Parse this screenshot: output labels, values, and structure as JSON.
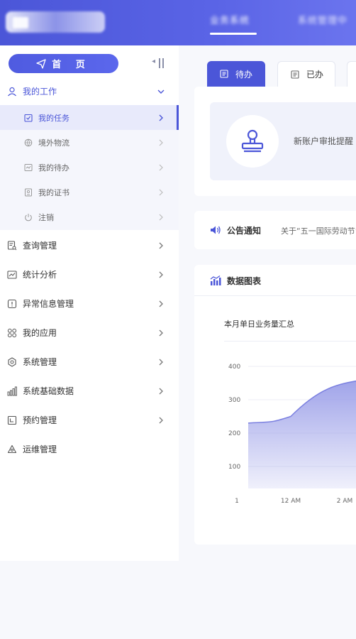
{
  "header": {
    "nav": [
      {
        "label": "业务系统"
      },
      {
        "label": "系统管理中"
      }
    ]
  },
  "sidebar": {
    "home_label": "首 页",
    "groups": [
      {
        "label": "我的工作",
        "icon": "user-icon",
        "expanded": true,
        "children": [
          {
            "label": "我的任务",
            "icon": "task-icon",
            "active": true
          },
          {
            "label": "境外物流",
            "icon": "globe-icon"
          },
          {
            "label": "我的待办",
            "icon": "todo-icon"
          },
          {
            "label": "我的证书",
            "icon": "certificate-icon"
          },
          {
            "label": "注销",
            "icon": "power-icon"
          }
        ]
      },
      {
        "label": "查询管理",
        "icon": "query-icon"
      },
      {
        "label": "统计分析",
        "icon": "stats-icon"
      },
      {
        "label": "异常信息管理",
        "icon": "warning-icon"
      },
      {
        "label": "我的应用",
        "icon": "apps-icon"
      },
      {
        "label": "系统管理",
        "icon": "gear-icon"
      },
      {
        "label": "系统基础数据",
        "icon": "bars-icon"
      },
      {
        "label": "预约管理",
        "icon": "calendar-icon"
      },
      {
        "label": "运维管理",
        "icon": "ops-icon"
      }
    ]
  },
  "tabs": [
    {
      "label": "待办",
      "active": true
    },
    {
      "label": "已办",
      "active": false
    }
  ],
  "task_notice": {
    "text": "新账户审批提醒"
  },
  "announcement": {
    "title": "公告通知",
    "text": "关于“五一国际劳动节”"
  },
  "chart_card": {
    "title": "数据图表",
    "subtitle": "本月单日业务量汇总"
  },
  "colors": {
    "primary": "#4b56d8",
    "area_fill": "#9a9ee8"
  },
  "chart_data": {
    "type": "area",
    "x": [
      "1",
      "12 AM",
      "2 AM"
    ],
    "y_ticks": [
      100,
      200,
      300,
      400
    ],
    "ylim": [
      0,
      450
    ],
    "series": [
      {
        "x": [
          "1",
          "12 AM",
          "2 AM"
        ],
        "values": [
          230,
          250,
          360
        ]
      }
    ],
    "title": "本月单日业务量汇总"
  }
}
